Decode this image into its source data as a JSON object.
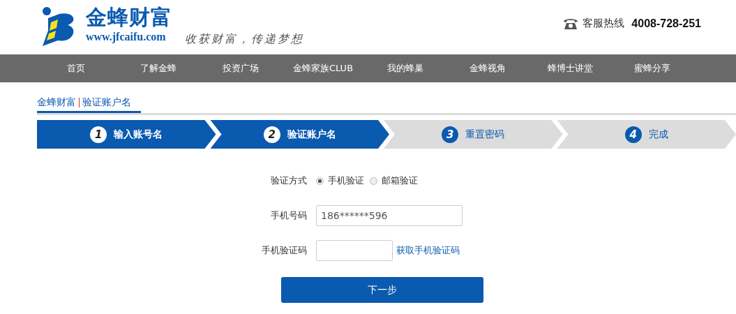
{
  "header": {
    "brand": "金蜂财富",
    "url": "www.jfcaifu.com",
    "slogan": "收获财富，传递梦想",
    "hotline_label": "客服热线",
    "hotline_number": "4008-728-251"
  },
  "nav": [
    "首页",
    "了解金蜂",
    "投资广场",
    "金蜂家族CLUB",
    "我的蜂巢",
    "金蜂视角",
    "蜂博士讲堂",
    "蜜蜂分享"
  ],
  "breadcrumb": [
    "金蜂财富",
    "验证账户名"
  ],
  "steps": [
    {
      "number": "1",
      "label": "输入账号名",
      "done": true
    },
    {
      "number": "2",
      "label": "验证账户名",
      "done": true
    },
    {
      "number": "3",
      "label": "重置密码",
      "done": false
    },
    {
      "number": "4",
      "label": "完成",
      "done": false
    }
  ],
  "form": {
    "method_label": "验证方式",
    "methods": [
      {
        "label": "手机验证",
        "selected": true
      },
      {
        "label": "邮箱验证",
        "selected": false
      }
    ],
    "phone_label": "手机号码",
    "phone_value": "186******596",
    "code_label": "手机验证码",
    "code_link": "获取手机验证码",
    "submit": "下一步"
  }
}
